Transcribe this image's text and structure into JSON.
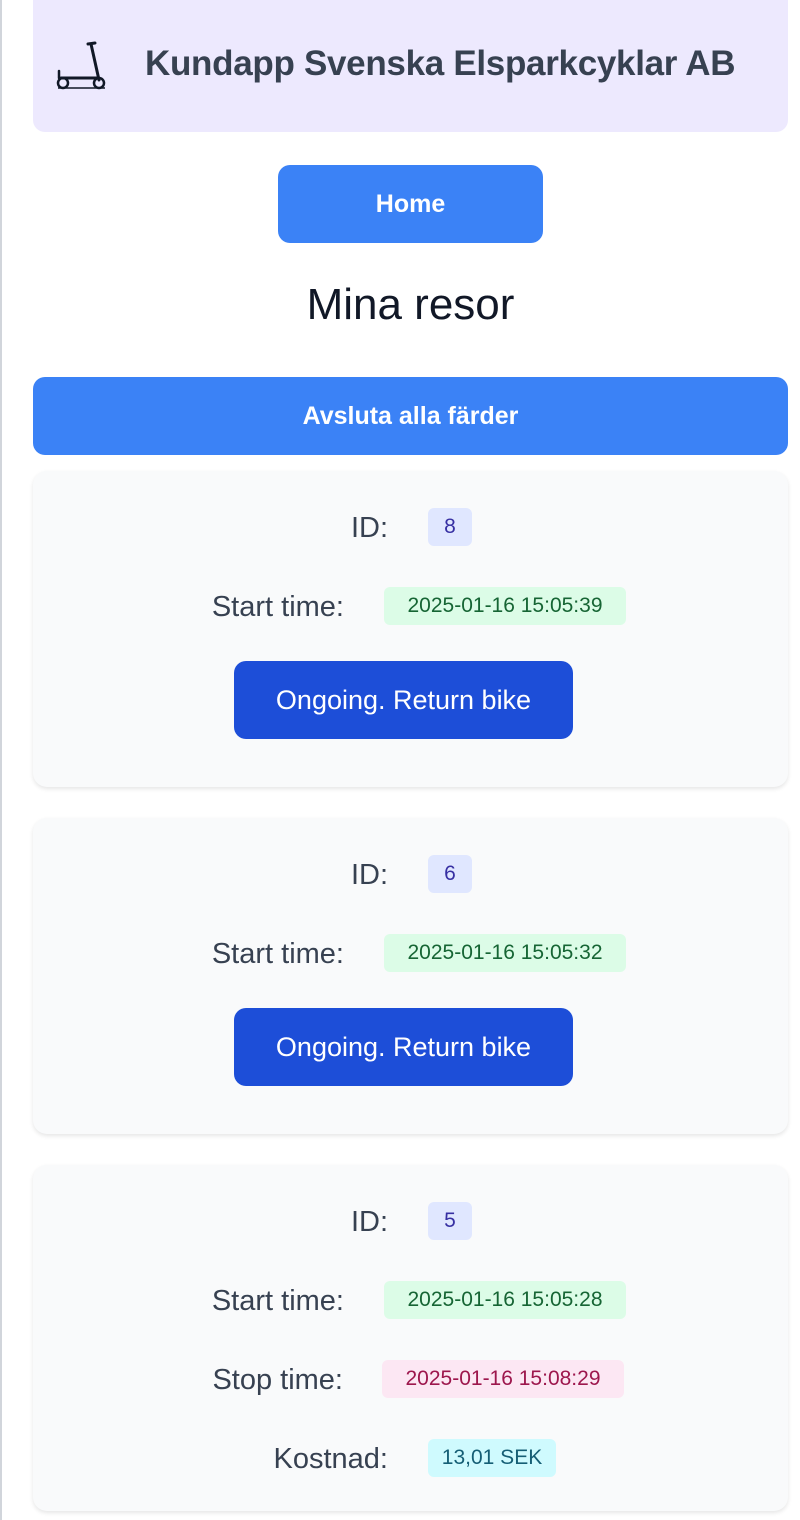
{
  "header": {
    "logo_icon": "kick-scooter-icon",
    "title": "Kundapp Svenska Elsparkcyklar AB"
  },
  "nav": {
    "home_label": "Home"
  },
  "page": {
    "title": "Mina resor",
    "end_all_label": "Avsluta alla färder"
  },
  "labels": {
    "id": "ID:",
    "start_time": "Start time:",
    "stop_time": "Stop time:",
    "cost": "Kostnad:"
  },
  "trips": [
    {
      "id": "8",
      "start_time": "2025-01-16 15:05:39",
      "status": "ongoing",
      "action_label": "Ongoing. Return bike"
    },
    {
      "id": "6",
      "start_time": "2025-01-16 15:05:32",
      "status": "ongoing",
      "action_label": "Ongoing. Return bike"
    },
    {
      "id": "5",
      "start_time": "2025-01-16 15:05:28",
      "stop_time": "2025-01-16 15:08:29",
      "cost": "13,01 SEK",
      "status": "finished"
    }
  ],
  "colors": {
    "header_bg": "#ede9fe",
    "primary_button": "#3b82f6",
    "return_button": "#1d4ed8",
    "card_bg": "#f9fafb",
    "id_badge": "#e0e7ff",
    "start_badge": "#dcfce7",
    "stop_badge": "#fce7f3",
    "cost_badge": "#cffafe"
  }
}
